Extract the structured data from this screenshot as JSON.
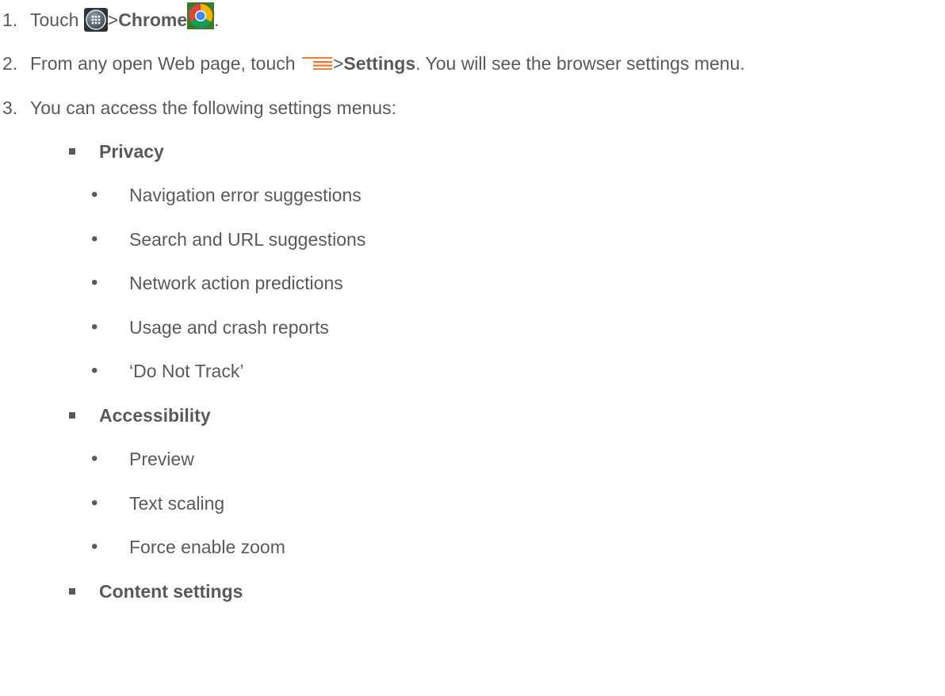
{
  "steps": [
    {
      "number": "1.",
      "text_before": "Touch ",
      "sep": ">",
      "bold": "Chrome",
      "text_after": ".",
      "icons": [
        "apps-launcher-icon",
        "chrome-icon"
      ]
    },
    {
      "number": "2.",
      "text_before": "From any open Web page, touch ",
      "sep": ">",
      "bold": "Settings",
      "text_after": ". You will see the browser settings menu.",
      "icons": [
        "menu-icon"
      ]
    },
    {
      "number": "3.",
      "text": "You can access the following settings menus:"
    }
  ],
  "sections": [
    {
      "title": "Privacy",
      "items": [
        "Navigation error suggestions",
        "Search and URL suggestions",
        "Network action predictions",
        "Usage and crash reports",
        "‘Do Not Track’"
      ]
    },
    {
      "title": "Accessibility",
      "items": [
        "Preview",
        "Text scaling",
        "Force enable zoom"
      ]
    },
    {
      "title": "Content settings",
      "items": []
    }
  ],
  "colors": {
    "text": "#595959",
    "menu_icon": "#f47b3a",
    "apps_icon": "#5a6470"
  }
}
